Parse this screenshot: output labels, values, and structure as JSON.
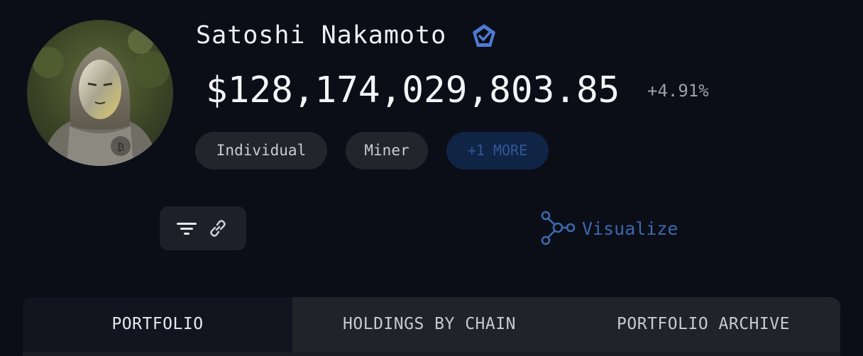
{
  "profile": {
    "name": "Satoshi Nakamoto",
    "verified_icon": "verified-badge-icon",
    "portfolio_value": "$128,174,029,803.85",
    "change_percent": "+4.91%",
    "avatar": "masked-figure-avatar"
  },
  "tags": [
    {
      "label": "Individual"
    },
    {
      "label": "Miner"
    },
    {
      "label": "+1 MORE"
    }
  ],
  "toolbar": {
    "filter_icon": "filter-icon",
    "link_icon": "link-icon"
  },
  "visualize": {
    "label": "Visualize",
    "icon": "graph-nodes-icon"
  },
  "tabs": [
    {
      "label": "PORTFOLIO",
      "active": true
    },
    {
      "label": "HOLDINGS BY CHAIN",
      "active": false
    },
    {
      "label": "PORTFOLIO ARCHIVE",
      "active": false
    }
  ],
  "colors": {
    "background": "#0b0e17",
    "accent_blue": "#3d68ad",
    "tag_background": "#23252c",
    "more_tag_background": "#102446"
  }
}
